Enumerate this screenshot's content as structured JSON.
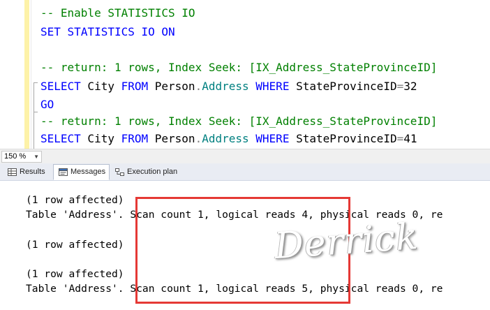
{
  "editor": {
    "lines": [
      {
        "tokens": [
          {
            "t": "-- Enable STATISTICS IO",
            "c": "comment"
          }
        ]
      },
      {
        "tokens": [
          {
            "t": "SET",
            "c": "kw"
          },
          {
            "t": " ",
            "c": "id"
          },
          {
            "t": "STATISTICS",
            "c": "kw"
          },
          {
            "t": " ",
            "c": "id"
          },
          {
            "t": "IO",
            "c": "kw"
          },
          {
            "t": " ",
            "c": "id"
          },
          {
            "t": "ON",
            "c": "kw"
          }
        ]
      },
      {
        "tokens": []
      },
      {
        "tokens": [
          {
            "t": "-- return: 1 rows, Index Seek: [IX_Address_StateProvinceID]",
            "c": "comment"
          }
        ]
      },
      {
        "tokens": [
          {
            "t": "SELECT",
            "c": "kw"
          },
          {
            "t": " City ",
            "c": "id"
          },
          {
            "t": "FROM",
            "c": "kw"
          },
          {
            "t": " Person",
            "c": "id"
          },
          {
            "t": ".",
            "c": "op"
          },
          {
            "t": "Address",
            "c": "obj"
          },
          {
            "t": " ",
            "c": "id"
          },
          {
            "t": "WHERE",
            "c": "kw"
          },
          {
            "t": " StateProvinceID",
            "c": "id"
          },
          {
            "t": "=",
            "c": "op"
          },
          {
            "t": "32",
            "c": "id"
          }
        ]
      },
      {
        "tokens": [
          {
            "t": "GO",
            "c": "kw"
          }
        ]
      },
      {
        "tokens": [
          {
            "t": "-- return: 1 rows, Index Seek: [IX_Address_StateProvinceID]",
            "c": "comment"
          }
        ]
      },
      {
        "tokens": [
          {
            "t": "SELECT",
            "c": "kw"
          },
          {
            "t": " City ",
            "c": "id"
          },
          {
            "t": "FROM",
            "c": "kw"
          },
          {
            "t": " Person",
            "c": "id"
          },
          {
            "t": ".",
            "c": "op"
          },
          {
            "t": "Address",
            "c": "obj"
          },
          {
            "t": " ",
            "c": "id"
          },
          {
            "t": "WHERE",
            "c": "kw"
          },
          {
            "t": " StateProvinceID",
            "c": "id"
          },
          {
            "t": "=",
            "c": "op"
          },
          {
            "t": "41",
            "c": "id"
          }
        ]
      }
    ]
  },
  "zoom": {
    "value": "150 %"
  },
  "tabs": [
    {
      "label": "Results",
      "icon": "grid-icon"
    },
    {
      "label": "Messages",
      "icon": "message-icon",
      "active": true
    },
    {
      "label": "Execution plan",
      "icon": "execution-plan-icon"
    }
  ],
  "messages": {
    "lines": [
      "(1 row affected)",
      "Table 'Address'. Scan count 1, logical reads 4, physical reads 0, re",
      "",
      "(1 row affected)",
      "",
      "(1 row affected)",
      "Table 'Address'. Scan count 1, logical reads 5, physical reads 0, re"
    ]
  },
  "watermark": "Derrick",
  "colors": {
    "comment": "#008000",
    "keyword": "#0000ff",
    "object": "#008080",
    "highlight": "#e53935"
  }
}
